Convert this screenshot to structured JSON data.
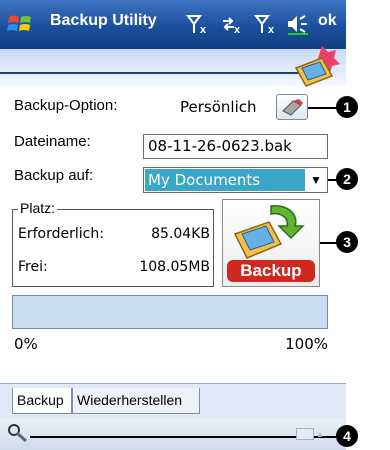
{
  "titlebar": {
    "title": "Backup Utility",
    "status_icons": [
      "signal-off-icon",
      "sync-off-icon",
      "phone-signal-off-icon",
      "volume-icon"
    ],
    "ok_label": "ok"
  },
  "form": {
    "backup_option_label": "Backup-Option:",
    "backup_option_value": "Persönlich",
    "filename_label": "Dateiname:",
    "filename_value": "08-11-26-0623.bak",
    "backup_to_label": "Backup auf:",
    "backup_to_value": "My Documents"
  },
  "space": {
    "group_label": "Platz:",
    "required_label": "Erforderlich:",
    "required_value": "85.04KB",
    "free_label": "Frei:",
    "free_value": "108.05MB",
    "backup_button_label": "Backup"
  },
  "progress": {
    "value": 0,
    "min_label": "0%",
    "max_label": "100%"
  },
  "tabs": [
    {
      "label": "Backup",
      "selected": true
    },
    {
      "label": "Wiederherstellen",
      "selected": false
    }
  ],
  "callouts": [
    "1",
    "2",
    "3",
    "4"
  ],
  "colors": {
    "titlebar": "#1c4f9c",
    "selection": "#3aa6c8",
    "progress_track": "#c8def0",
    "backup_label_red": "#d0281e"
  }
}
